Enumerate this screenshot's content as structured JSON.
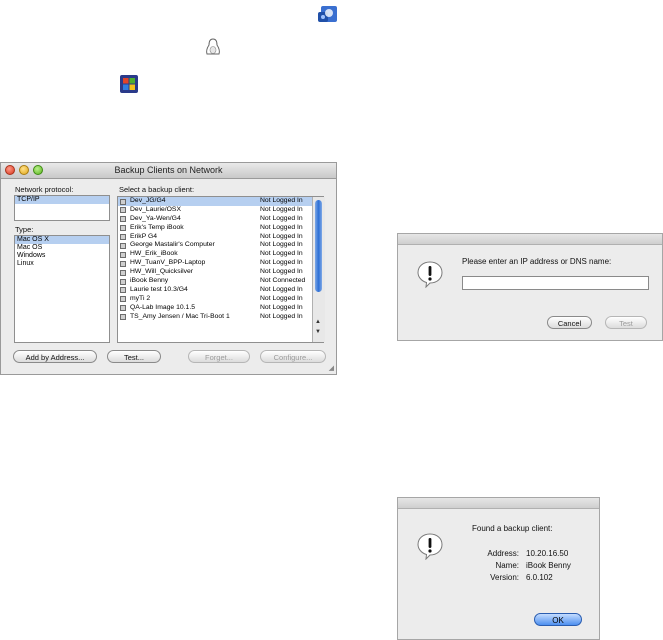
{
  "window": {
    "title": "Backup Clients on Network",
    "protocol_label": "Network protocol:",
    "protocols": [
      "TCP/IP"
    ],
    "type_label": "Type:",
    "types": [
      "Mac OS X",
      "Mac OS",
      "Windows",
      "Linux"
    ],
    "clients_label": "Select a backup client:",
    "clients": [
      {
        "name": "Dev_JG/G4",
        "status": "Not Logged In"
      },
      {
        "name": "Dev_Laurie/OSX",
        "status": "Not Logged In"
      },
      {
        "name": "Dev_Ya-Wen/G4",
        "status": "Not Logged In"
      },
      {
        "name": "Erik's Temp iBook",
        "status": "Not Logged In"
      },
      {
        "name": "ErikP G4",
        "status": "Not Logged In"
      },
      {
        "name": "George Mastalir's Computer",
        "status": "Not Logged In"
      },
      {
        "name": "HW_Erik_iBook",
        "status": "Not Logged In"
      },
      {
        "name": "HW_TuanV_BPP-Laptop",
        "status": "Not Logged In"
      },
      {
        "name": "HW_Will_Quicksilver",
        "status": "Not Logged In"
      },
      {
        "name": "iBook Benny",
        "status": "Not Connected"
      },
      {
        "name": "Laurie test 10.3/G4",
        "status": "Not Logged In"
      },
      {
        "name": "myTi 2",
        "status": "Not Logged In"
      },
      {
        "name": "QA-Lab Image 10.1.5",
        "status": "Not Logged In"
      },
      {
        "name": "TS_Amy Jensen / Mac Tri-Boot 1",
        "status": "Not Logged In"
      }
    ],
    "buttons": {
      "add": "Add by Address...",
      "test": "Test...",
      "forget": "Forget...",
      "configure": "Configure..."
    }
  },
  "ip_dialog": {
    "prompt": "Please enter an IP address or DNS name:",
    "input_value": "",
    "cancel": "Cancel",
    "test": "Test"
  },
  "found_dialog": {
    "heading": "Found a backup client:",
    "address_label": "Address:",
    "address": "10.20.16.50",
    "name_label": "Name:",
    "name": "iBook Benny",
    "version_label": "Version:",
    "version": "6.0.102",
    "ok": "OK"
  },
  "icons": [
    "mac-os-x-icon",
    "linux-tux-icon",
    "windows-icon",
    "alert-icon"
  ],
  "colors": {
    "selection": "#b6cff0",
    "accent": "#2d6fd6"
  }
}
